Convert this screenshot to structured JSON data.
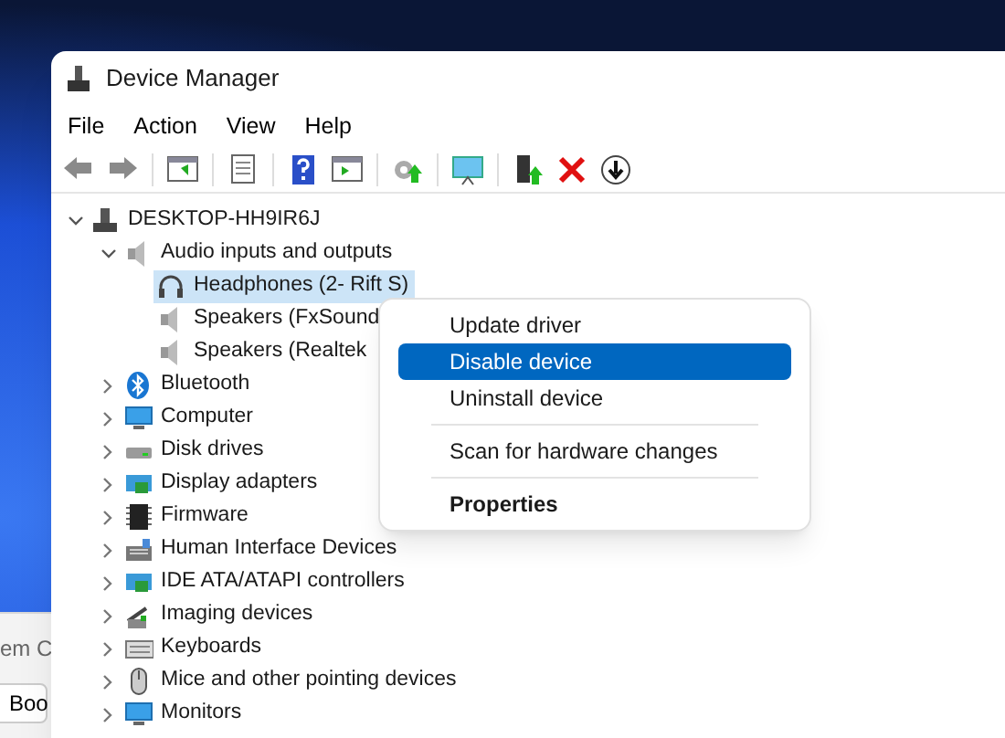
{
  "background_window": {
    "texts": [
      "em C",
      "Boo"
    ]
  },
  "window": {
    "title": "Device Manager"
  },
  "menu_bar": [
    "File",
    "Action",
    "View",
    "Help"
  ],
  "toolbar": [
    {
      "kind": "back"
    },
    {
      "kind": "forward"
    },
    {
      "kind": "sep"
    },
    {
      "kind": "panel"
    },
    {
      "kind": "sep"
    },
    {
      "kind": "properties"
    },
    {
      "kind": "sep"
    },
    {
      "kind": "help"
    },
    {
      "kind": "view"
    },
    {
      "kind": "sep"
    },
    {
      "kind": "scan"
    },
    {
      "kind": "sep"
    },
    {
      "kind": "monitor"
    },
    {
      "kind": "sep"
    },
    {
      "kind": "update"
    },
    {
      "kind": "remove"
    },
    {
      "kind": "disable"
    }
  ],
  "tree": [
    {
      "label": "DESKTOP-HH9IR6J",
      "kind": "computer",
      "expanded": true,
      "selected": false,
      "children": [
        {
          "label": "Audio inputs and outputs",
          "kind": "speaker",
          "expanded": true,
          "selected": false,
          "children": [
            {
              "label": "Headphones (2- Rift S)",
              "kind": "headphones",
              "selected": true
            },
            {
              "label": "Speakers (FxSound",
              "kind": "speaker",
              "selected": false
            },
            {
              "label": "Speakers (Realtek",
              "kind": "speaker",
              "selected": false
            }
          ]
        },
        {
          "label": "Bluetooth",
          "kind": "bluetooth",
          "expanded": false,
          "selected": false
        },
        {
          "label": "Computer",
          "kind": "monitor",
          "expanded": false,
          "selected": false
        },
        {
          "label": "Disk drives",
          "kind": "disk",
          "expanded": false,
          "selected": false
        },
        {
          "label": "Display adapters",
          "kind": "adapter",
          "expanded": false,
          "selected": false
        },
        {
          "label": "Firmware",
          "kind": "chip",
          "expanded": false,
          "selected": false
        },
        {
          "label": "Human Interface Devices",
          "kind": "hid",
          "expanded": false,
          "selected": false
        },
        {
          "label": "IDE ATA/ATAPI controllers",
          "kind": "adapter",
          "expanded": false,
          "selected": false
        },
        {
          "label": "Imaging devices",
          "kind": "camera",
          "expanded": false,
          "selected": false
        },
        {
          "label": "Keyboards",
          "kind": "keyboard",
          "expanded": false,
          "selected": false
        },
        {
          "label": "Mice and other pointing devices",
          "kind": "mouse",
          "expanded": false,
          "selected": false
        },
        {
          "label": "Monitors",
          "kind": "monitor",
          "expanded": false,
          "selected": false
        }
      ]
    }
  ],
  "context_menu": [
    [
      {
        "label": "Update driver",
        "selected": false,
        "default": false
      },
      {
        "label": "Disable device",
        "selected": true,
        "default": false
      },
      {
        "label": "Uninstall device",
        "selected": false,
        "default": false
      }
    ],
    [
      {
        "label": "Scan for hardware changes",
        "selected": false,
        "default": false
      }
    ],
    [
      {
        "label": "Properties",
        "selected": false,
        "default": true
      }
    ]
  ]
}
